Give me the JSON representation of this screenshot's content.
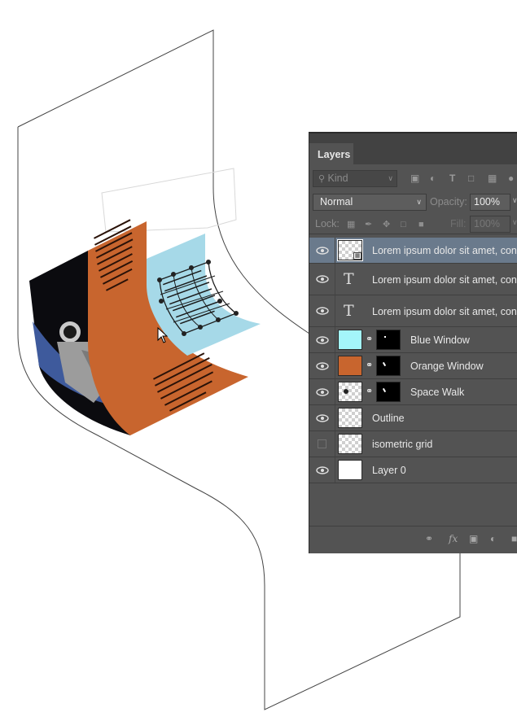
{
  "panel": {
    "tab_label": "Layers",
    "kind_filter": "Kind",
    "blend_mode": "Normal",
    "opacity_label": "Opacity:",
    "opacity_value": "100%",
    "lock_label": "Lock:",
    "fill_label": "Fill:",
    "fill_value": "100%"
  },
  "layers": [
    {
      "name": "Lorem ipsum dolor sit amet, con",
      "type": "smart-object",
      "visible": true,
      "selected": true
    },
    {
      "name": "Lorem ipsum dolor sit amet, con",
      "type": "text",
      "visible": true,
      "selected": false
    },
    {
      "name": "Lorem ipsum dolor sit amet, con",
      "type": "text",
      "visible": true,
      "selected": false
    },
    {
      "name": "Blue Window",
      "type": "masked",
      "color": "#a4f5fa",
      "visible": true,
      "selected": false
    },
    {
      "name": "Orange Window",
      "type": "masked",
      "color": "#c8652e",
      "visible": true,
      "selected": false
    },
    {
      "name": "Space Walk",
      "type": "masked",
      "visible": true,
      "selected": false
    },
    {
      "name": "Outline",
      "type": "pixel",
      "visible": true,
      "selected": false
    },
    {
      "name": "isometric grid",
      "type": "pixel",
      "visible": false,
      "selected": false
    },
    {
      "name": "Layer 0",
      "type": "white",
      "visible": true,
      "selected": false
    }
  ],
  "colors": {
    "panel_bg": "#535353",
    "selected_row": "#6a7a8c",
    "orange_window": "#c8652e",
    "blue_window": "#a6d9e8"
  }
}
